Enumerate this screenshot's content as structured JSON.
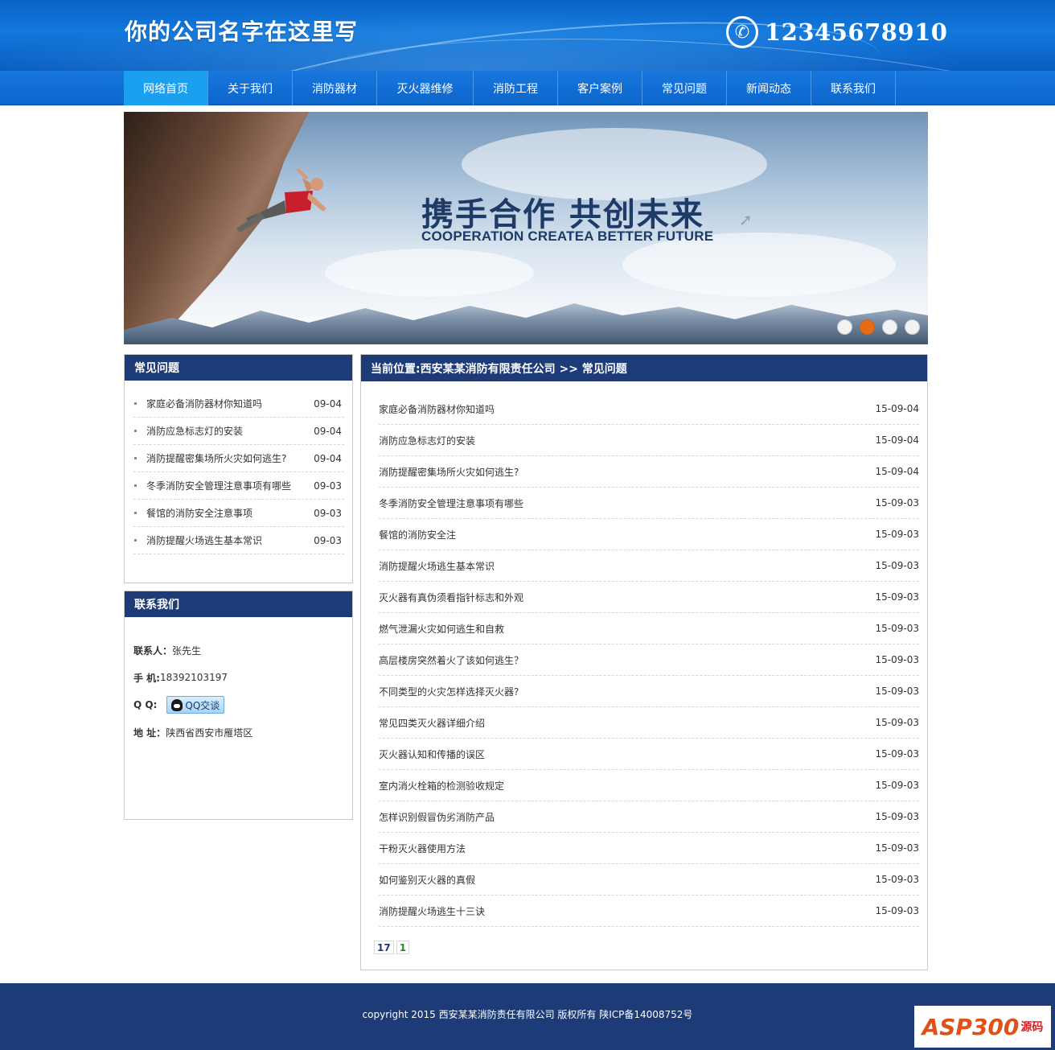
{
  "header": {
    "company_name": "你的公司名字在这里写",
    "phone": "12345678910"
  },
  "nav": {
    "items": [
      {
        "label": "网络首页",
        "width": 105,
        "active": true
      },
      {
        "label": "关于我们",
        "width": 105
      },
      {
        "label": "消防器材",
        "width": 105
      },
      {
        "label": "灭火器维修",
        "width": 120
      },
      {
        "label": "消防工程",
        "width": 105
      },
      {
        "label": "客户案例",
        "width": 105
      },
      {
        "label": "常见问题",
        "width": 105
      },
      {
        "label": "新闻动态",
        "width": 105
      },
      {
        "label": "联系我们",
        "width": 105
      }
    ]
  },
  "banner": {
    "title": "携手合作  共创未来",
    "subtitle": "COOPERATION CREATEA BETTER FUTURE",
    "dots": [
      false,
      true,
      false,
      false
    ]
  },
  "faq_side": {
    "title": "常见问题",
    "items": [
      {
        "title": "家庭必备消防器材你知道吗",
        "date": "09-04"
      },
      {
        "title": "消防应急标志灯的安装",
        "date": "09-04"
      },
      {
        "title": "消防提醒密集场所火灾如何逃生?",
        "date": "09-04"
      },
      {
        "title": "冬季消防安全管理注意事项有哪些",
        "date": "09-03"
      },
      {
        "title": "餐馆的消防安全注意事项",
        "date": "09-03"
      },
      {
        "title": "消防提醒火场逃生基本常识",
        "date": "09-03"
      }
    ]
  },
  "contact": {
    "title": "联系我们",
    "person_label": "联系人：",
    "person": "张先生",
    "mobile_label": "手 机:",
    "mobile": "18392103197",
    "qq_label": "Q Q:",
    "qq_button": "QQ交谈",
    "address_label": "地 址：",
    "address": "陕西省西安市雁塔区"
  },
  "main": {
    "breadcrumb": "当前位置:西安某某消防有限责任公司 >> 常见问题",
    "items": [
      {
        "title": "家庭必备消防器材你知道吗",
        "date": "15-09-04"
      },
      {
        "title": "消防应急标志灯的安装",
        "date": "15-09-04"
      },
      {
        "title": "消防提醒密集场所火灾如何逃生?",
        "date": "15-09-04"
      },
      {
        "title": "冬季消防安全管理注意事项有哪些",
        "date": "15-09-03"
      },
      {
        "title": "餐馆的消防安全注",
        "date": "15-09-03"
      },
      {
        "title": "消防提醒火场逃生基本常识",
        "date": "15-09-03"
      },
      {
        "title": "灭火器有真伪须看指针标志和外观",
        "date": "15-09-03"
      },
      {
        "title": "燃气泄漏火灾如何逃生和自救",
        "date": "15-09-03"
      },
      {
        "title": "高层楼房突然着火了该如何逃生？",
        "date": "15-09-03"
      },
      {
        "title": "不同类型的火灾怎样选择灭火器?",
        "date": "15-09-03"
      },
      {
        "title": "常见四类灭火器详细介绍",
        "date": "15-09-03"
      },
      {
        "title": "灭火器认知和传播的误区",
        "date": "15-09-03"
      },
      {
        "title": "室内消火栓箱的检测验收规定",
        "date": "15-09-03"
      },
      {
        "title": "怎样识别假冒伪劣消防产品",
        "date": "15-09-03"
      },
      {
        "title": "干粉灭火器使用方法",
        "date": "15-09-03"
      },
      {
        "title": "如何鉴别灭火器的真假",
        "date": "15-09-03"
      },
      {
        "title": "消防提醒火场逃生十三诀",
        "date": "15-09-03"
      }
    ],
    "pager": {
      "total": "17",
      "page": "1"
    }
  },
  "footer": {
    "copyright": "copyright 2015 西安某某消防责任有限公司 版权所有 陕ICP备14008752号",
    "watermark": "ASP300",
    "watermark_sub": "源码"
  },
  "colors": {
    "nav_active": "#1ba0f0",
    "panel_head": "#1d3b76",
    "footer": "#1d3b76",
    "dot_active": "#e96b15"
  },
  "icons": {
    "phone": "phone-icon",
    "qq": "qq-penguin-icon"
  }
}
